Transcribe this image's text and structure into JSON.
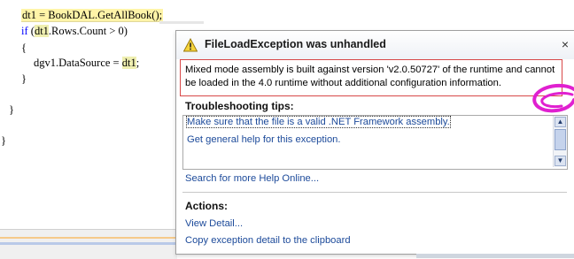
{
  "code": {
    "line1": "dt1 = BookDAL.GetAllBook();",
    "line2_kw": "if",
    "line2_var": "dt1",
    "line2_rest": ".Rows.Count > 0)",
    "line3": "{",
    "line4_left": "dgv1.DataSource = ",
    "line4_var": "dt1",
    "line4_end": ";",
    "line5": "}",
    "line6": "}",
    "line7": "}"
  },
  "popup": {
    "title": "FileLoadException was unhandled",
    "close_glyph": "×",
    "message": "Mixed mode assembly is built against version 'v2.0.50727' of the runtime and cannot be loaded in the 4.0 runtime without additional configuration information.",
    "troubleshooting_title": "Troubleshooting tips:",
    "tips": [
      "Make sure that the file is a valid .NET Framework assembly.",
      "Get general help for this exception."
    ],
    "search_link": "Search for more Help Online...",
    "actions_title": "Actions:",
    "actions": [
      "View Detail...",
      "Copy exception detail to the clipboard"
    ]
  },
  "icons": {
    "warning": "warning-icon",
    "close": "close-icon",
    "scroll_up": "chevron-up-icon",
    "scroll_down": "chevron-down-icon"
  },
  "colors": {
    "link": "#1c4a9a",
    "message_border": "#d84848",
    "current_line_highlight": "#fff4a8",
    "keyword": "#0000ff",
    "annotation": "#e020d0"
  }
}
